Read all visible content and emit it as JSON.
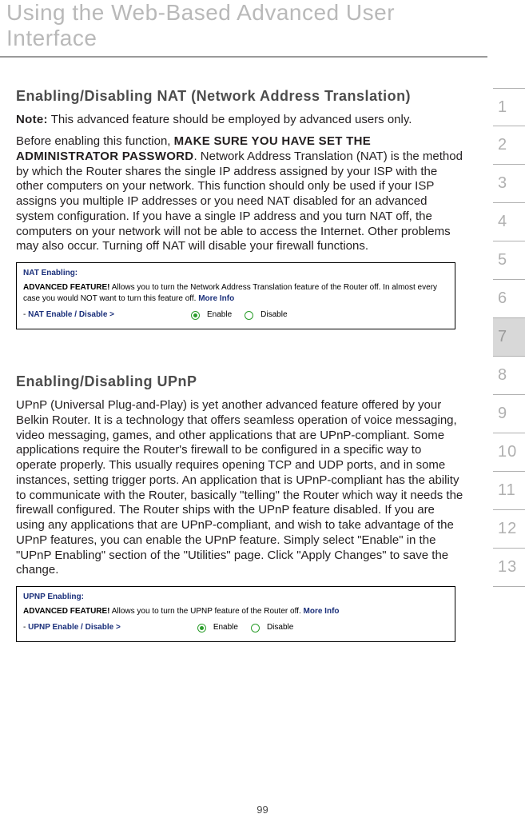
{
  "header": {
    "title": "Using the Web-Based Advanced User Interface"
  },
  "sections": {
    "nat": {
      "heading": "Enabling/Disabling NAT (Network Address Translation)",
      "note_label": "Note:",
      "note_text": " This advanced feature should be employed by advanced users only.",
      "para_lead": "Before enabling this function, ",
      "para_bold": "MAKE SURE YOU HAVE SET THE ADMINISTRATOR PASSWORD",
      "para_rest": ". Network Address Translation (NAT) is the method by which the Router shares the single IP address assigned by your ISP with the other computers on your network. This function should only be used if your ISP assigns you multiple IP addresses or you need NAT disabled for an advanced system configuration. If you have a single IP address and you turn NAT off, the computers on your network will not be able to access the Internet. Other problems may also occur. Turning off NAT will disable your firewall functions."
    },
    "upnp": {
      "heading": "Enabling/Disabling UPnP",
      "para": "UPnP (Universal Plug-and-Play) is yet another advanced feature offered by your Belkin Router. It is a technology that offers seamless operation of voice messaging, video messaging, games, and other applications that are UPnP-compliant. Some applications require the Router's firewall to be configured in a specific way to operate properly. This usually requires opening TCP and UDP ports, and in some instances, setting trigger ports. An application that is UPnP-compliant has the ability to communicate with the Router, basically \"telling\" the Router which way it needs the firewall configured. The Router ships with the UPnP feature disabled. If you are using any applications that are UPnP-compliant, and wish to take advantage of the UPnP features, you can enable the UPnP feature. Simply select \"Enable\" in the \"UPnP Enabling\" section of the \"Utilities\" page. Click \"Apply Changes\" to save the change."
    }
  },
  "ui_nat": {
    "title": "NAT Enabling:",
    "adv": "ADVANCED FEATURE!",
    "desc": " Allows you to turn the Network Address Translation feature of the Router off. In almost every case you would NOT want to turn this feature off. ",
    "more": "More Info",
    "row_prefix": "- ",
    "row_label": "NAT Enable / Disable >",
    "enable": "Enable",
    "disable": "Disable"
  },
  "ui_upnp": {
    "title": "UPNP Enabling:",
    "adv": "ADVANCED FEATURE!",
    "desc": " Allows you to turn the UPNP feature of the Router off. ",
    "more": "More Info",
    "row_prefix": "- ",
    "row_label": "UPNP Enable / Disable >",
    "enable": "Enable",
    "disable": "Disable"
  },
  "tabs": [
    "1",
    "2",
    "3",
    "4",
    "5",
    "6",
    "7",
    "8",
    "9",
    "10",
    "11",
    "12",
    "13"
  ],
  "active_tab_index": 6,
  "page_number": "99"
}
